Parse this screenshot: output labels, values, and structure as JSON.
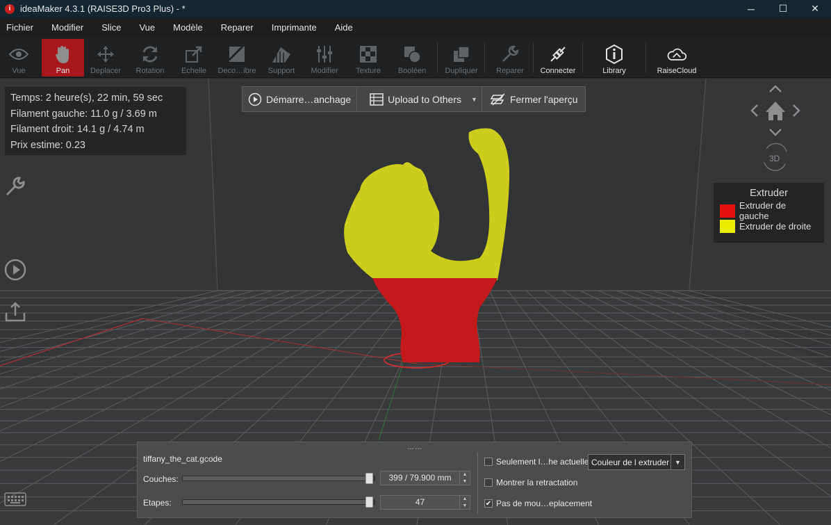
{
  "window": {
    "title": "ideaMaker 4.3.1 (RAISE3D Pro3 Plus) - *",
    "app_icon": "i",
    "min": "─",
    "max": "☐",
    "close": "✕"
  },
  "menu": [
    "Fichier",
    "Modifier",
    "Slice",
    "Vue",
    "Modèle",
    "Reparer",
    "Imprimante",
    "Aide"
  ],
  "toolbar": {
    "vue": "Vue",
    "pan": "Pan",
    "deplacer": "Deplacer",
    "rotation": "Rotation",
    "echelle": "Echelle",
    "deco": "Deco…ibre",
    "support": "Support",
    "modifier": "Modifier",
    "texture": "Texture",
    "booleen": "Booléen",
    "dupliquer": "Dupliquer",
    "reparer": "Reparer",
    "connecter": "Connecter",
    "library": "Library",
    "raisecloud": "RaiseCloud"
  },
  "stats": {
    "temps": "Temps: 2 heure(s), 22 min, 59 sec",
    "filament_gauche": "Filament gauche: 11.0 g / 3.69 m",
    "filament_droit": "Filament droit: 14.1 g / 4.74 m",
    "prix": "Prix estime: 0.23"
  },
  "preview": {
    "start": "Démarre…anchage",
    "upload": "Upload to Others",
    "close": "Fermer l'aperçu"
  },
  "nav": {
    "threed": "3D"
  },
  "legend": {
    "title": "Extruder",
    "items": [
      {
        "label": "Extruder de gauche",
        "color": "#e51010"
      },
      {
        "label": "Extruder de droite",
        "color": "#ecec00"
      }
    ]
  },
  "model_colors": {
    "left": "#c41a1c",
    "right": "#cccc1c"
  },
  "panel": {
    "grip": "……",
    "filename": "tiffany_the_cat.gcode",
    "couches_label": "Couches:",
    "couches_value": "399 / 79.900 mm",
    "couches_fraction": 1.0,
    "etapes_label": "Etapes:",
    "etapes_value": "47",
    "etapes_fraction": 1.0,
    "only_current": "Seulement l…he actuelle",
    "show_retraction": "Montrer la retractation",
    "no_travel": "Pas de mou…eplacement",
    "only_current_checked": false,
    "show_retraction_checked": false,
    "no_travel_checked": true,
    "color_mode": "Couleur de l extruder"
  }
}
